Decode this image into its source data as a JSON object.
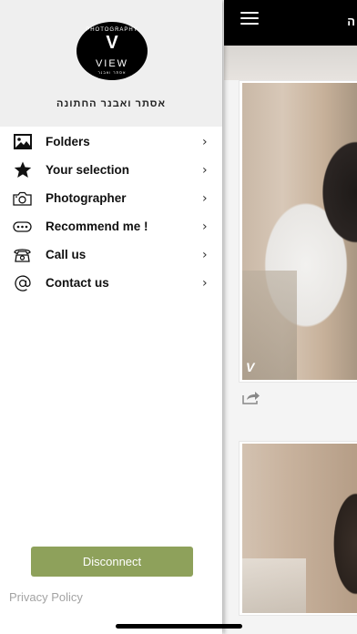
{
  "drawer": {
    "logo": {
      "top_text": "PHOTOGRAPHY",
      "mark": "V",
      "word": "VIEW",
      "sub_text": "אסתר ואבנר"
    },
    "album_name": "אסתר ואבנר החתונה",
    "menu": [
      {
        "label": "Folders",
        "icon": "image-icon"
      },
      {
        "label": "Your selection",
        "icon": "star-icon"
      },
      {
        "label": "Photographer",
        "icon": "camera-icon"
      },
      {
        "label": "Recommend me !",
        "icon": "chat-dots-icon"
      },
      {
        "label": "Call us",
        "icon": "phone-icon"
      },
      {
        "label": "Contact us",
        "icon": "at-icon"
      }
    ],
    "chevron": "›",
    "disconnect_label": "Disconnect",
    "privacy_label": "Privacy Policy"
  },
  "background": {
    "title": "ה",
    "watermark": "V"
  },
  "colors": {
    "accent": "#8ea15b",
    "topbar": "#000000",
    "drawer_header": "#efefef"
  }
}
